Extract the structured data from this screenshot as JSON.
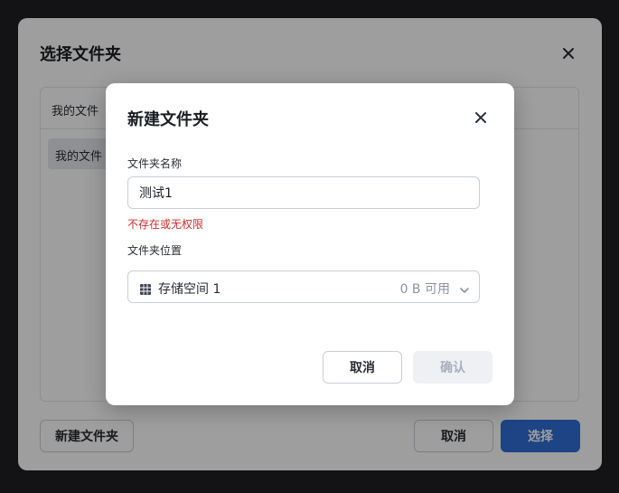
{
  "outer_dialog": {
    "title": "选择文件夹",
    "breadcrumb": "我的文件",
    "item_label": "我的文件",
    "new_folder_label": "新建文件夹",
    "cancel_label": "取消",
    "select_label": "选择"
  },
  "modal": {
    "title": "新建文件夹",
    "name_label": "文件夹名称",
    "name_value": "测试1",
    "error": "不存在或无权限",
    "location_label": "文件夹位置",
    "storage_name": "存储空间 1",
    "storage_free": "0 B 可用",
    "cancel_label": "取消",
    "confirm_label": "确认"
  },
  "icons": {
    "close": "close-icon",
    "storage": "storage-grid-icon",
    "chevron": "chevron-down-icon"
  },
  "colors": {
    "primary": "#2f6fd6",
    "error": "#d42a2a",
    "disabled_bg": "#eef0f4",
    "disabled_text": "#a8b0bd"
  }
}
